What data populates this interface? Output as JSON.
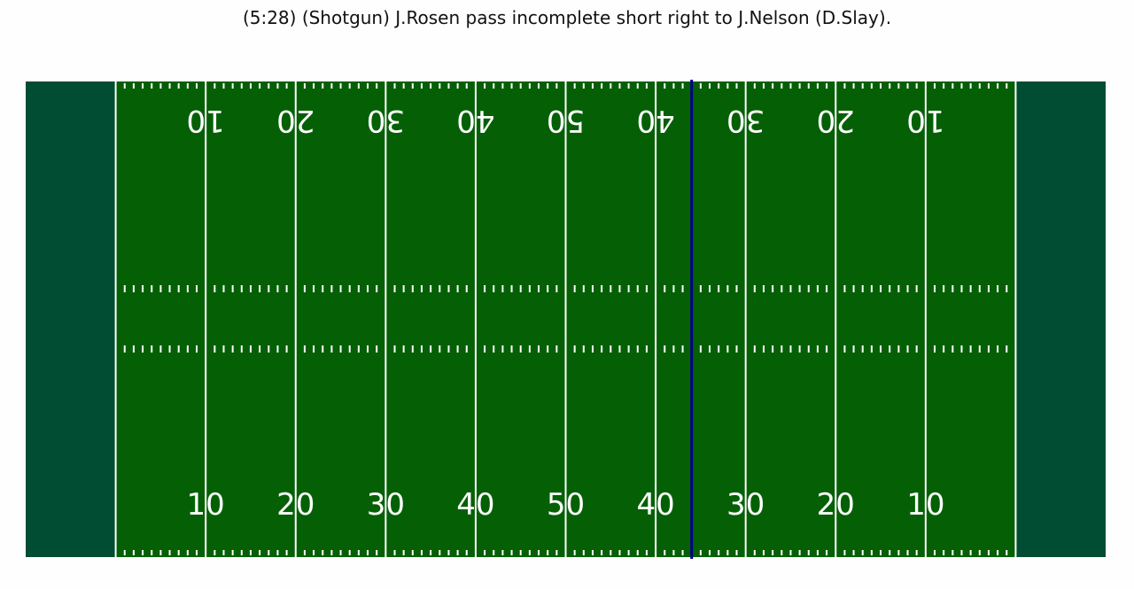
{
  "title": "(5:28) (Shotgun) J.Rosen pass incomplete short right to J.Nelson (D.Slay).",
  "field": {
    "colors": {
      "endzone": "#004d33",
      "turf": "#056005",
      "lines": "#ffffff",
      "line_of_scrimmage": "#00008b",
      "background": "#fefefe"
    },
    "total_length_yards": 120,
    "yard_numbers_bottom": [
      "10",
      "20",
      "30",
      "40",
      "50",
      "40",
      "30",
      "20",
      "10"
    ],
    "yard_numbers_top": [
      "10",
      "20",
      "30",
      "40",
      "50",
      "40",
      "30",
      "20",
      "10"
    ],
    "yard_number_positions_yards": [
      20,
      30,
      40,
      50,
      60,
      70,
      80,
      90,
      100
    ],
    "line_of_scrimmage_yards": 74
  }
}
